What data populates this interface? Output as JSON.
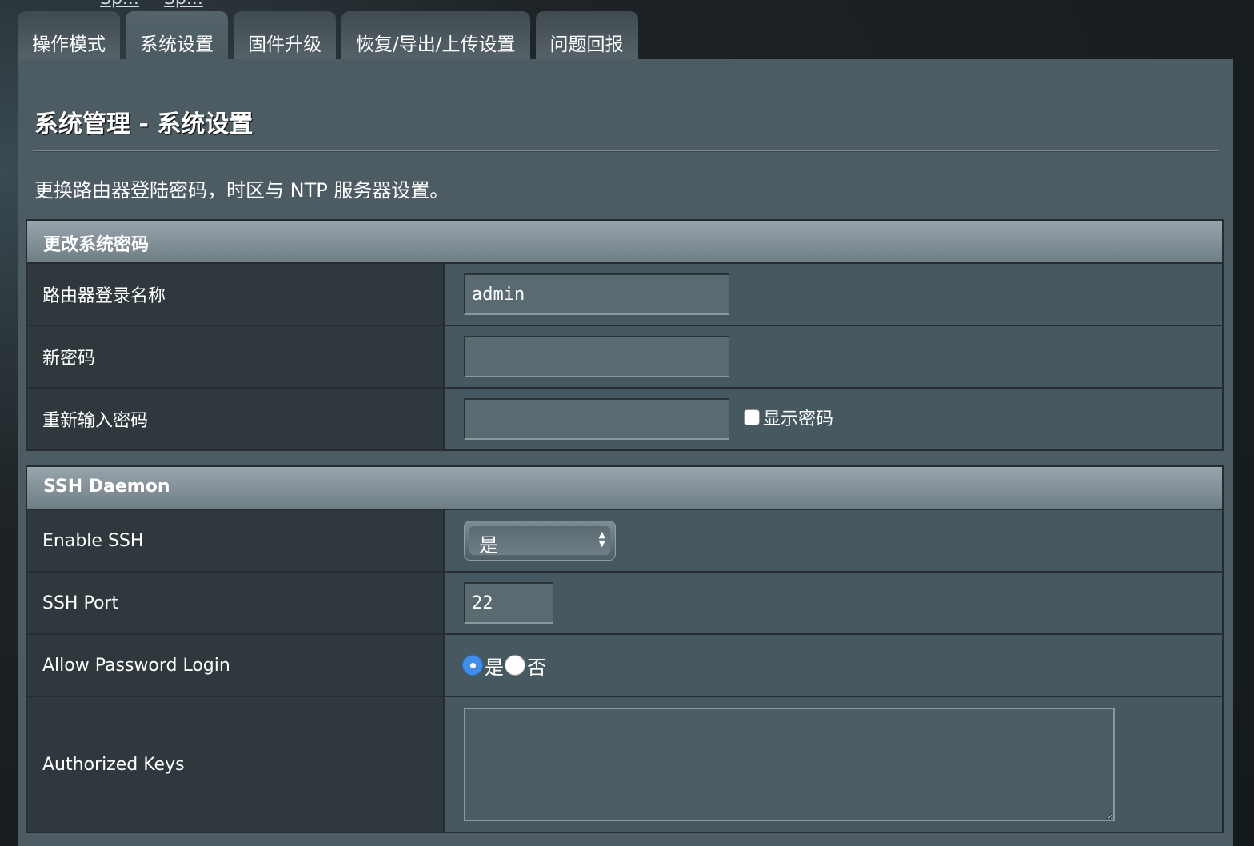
{
  "top_links": [
    "Sp...",
    "Sp..."
  ],
  "tabs": [
    {
      "label": "操作模式"
    },
    {
      "label": "系统设置"
    },
    {
      "label": "固件升级"
    },
    {
      "label": "恢复/导出/上传设置"
    },
    {
      "label": "问题回报"
    }
  ],
  "active_tab": "系统设置",
  "page": {
    "title": "系统管理 - 系统设置",
    "description": "更换路由器登陆密码，时区与 NTP 服务器设置。"
  },
  "password_section": {
    "header": "更改系统密码",
    "login_name_label": "路由器登录名称",
    "login_name_value": "admin",
    "new_password_label": "新密码",
    "new_password_value": "",
    "retype_password_label": "重新输入密码",
    "retype_password_value": "",
    "show_password_label": "显示密码",
    "show_password_checked": false
  },
  "ssh_section": {
    "header": "SSH Daemon",
    "enable_label": "Enable SSH",
    "enable_value": "是",
    "port_label": "SSH Port",
    "port_value": "22",
    "allow_password_label": "Allow Password Login",
    "radio_yes": "是",
    "radio_no": "否",
    "allow_password_selected": "是",
    "authorized_keys_label": "Authorized Keys",
    "authorized_keys_value": ""
  },
  "icons": {
    "select_arrows": "updown-arrows-icon",
    "resize_grip": "resize-grip-icon"
  },
  "colors": {
    "panel_bg": "#4d5b62",
    "label_cell_bg": "#2f393d",
    "radio_on": "#3f8ee8"
  }
}
